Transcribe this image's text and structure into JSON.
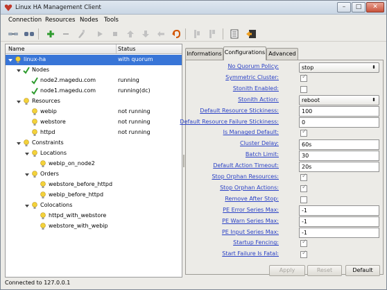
{
  "window": {
    "title": "Linux HA Management Client",
    "controls": [
      "–",
      "□",
      "✕"
    ]
  },
  "menu": [
    "Connection",
    "Resources",
    "Nodes",
    "Tools"
  ],
  "toolbar": {
    "icons": [
      "connect-icon",
      "disconnect-icon",
      "add-icon",
      "remove-icon",
      "cleanup-icon",
      "start-icon",
      "stop-icon",
      "move-up-icon",
      "move-down-icon",
      "migrate-icon",
      "unmigrate-icon",
      "standby-icon",
      "active-icon",
      "log-viewer-icon",
      "exit-icon"
    ]
  },
  "tree": {
    "columns": [
      "Name",
      "Status"
    ],
    "rows": [
      {
        "label": "linux-ha",
        "status": "with quorum",
        "level": 0,
        "icon": "bulb",
        "expanded": true,
        "selected": true
      },
      {
        "label": "Nodes",
        "status": "",
        "level": 1,
        "icon": "check",
        "expanded": true
      },
      {
        "label": "node2.magedu.com",
        "status": "running",
        "level": 2,
        "icon": "check"
      },
      {
        "label": "node1.magedu.com",
        "status": "running(dc)",
        "level": 2,
        "icon": "check"
      },
      {
        "label": "Resources",
        "status": "",
        "level": 1,
        "icon": "bulb",
        "expanded": true
      },
      {
        "label": "webip",
        "status": "not running",
        "level": 2,
        "icon": "bulb"
      },
      {
        "label": "webstore",
        "status": "not running",
        "level": 2,
        "icon": "bulb"
      },
      {
        "label": "httpd",
        "status": "not running",
        "level": 2,
        "icon": "bulb"
      },
      {
        "label": "Constraints",
        "status": "",
        "level": 1,
        "icon": "bulb",
        "expanded": true
      },
      {
        "label": "Locations",
        "status": "",
        "level": 2,
        "icon": "bulb",
        "expanded": true
      },
      {
        "label": "webip_on_node2",
        "status": "",
        "level": 3,
        "icon": "bulb"
      },
      {
        "label": "Orders",
        "status": "",
        "level": 2,
        "icon": "bulb",
        "expanded": true
      },
      {
        "label": "webstore_before_httpd",
        "status": "",
        "level": 3,
        "icon": "bulb"
      },
      {
        "label": "webip_before_httpd",
        "status": "",
        "level": 3,
        "icon": "bulb"
      },
      {
        "label": "Colocations",
        "status": "",
        "level": 2,
        "icon": "bulb",
        "expanded": true
      },
      {
        "label": "httpd_with_webstore",
        "status": "",
        "level": 3,
        "icon": "bulb"
      },
      {
        "label": "webstore_with_webip",
        "status": "",
        "level": 3,
        "icon": "bulb"
      }
    ]
  },
  "tabs": [
    "Informations",
    "Configurations",
    "Advanced"
  ],
  "active_tab": "Configurations",
  "config": [
    {
      "label": "No Quorum Policy:",
      "type": "select",
      "value": "stop"
    },
    {
      "label": "Symmetric Cluster:",
      "type": "check",
      "value": true
    },
    {
      "label": "Stonith Enabled:",
      "type": "check",
      "value": false
    },
    {
      "label": "Stonith Action:",
      "type": "select",
      "value": "reboot"
    },
    {
      "label": "Default Resource Stickiness:",
      "type": "text",
      "value": "100"
    },
    {
      "label": "Default Resource Failure Stickiness:",
      "type": "text",
      "value": "0"
    },
    {
      "label": "Is Managed Default:",
      "type": "check",
      "value": true
    },
    {
      "label": "Cluster Delay:",
      "type": "text",
      "value": "60s"
    },
    {
      "label": "Batch Limit:",
      "type": "text",
      "value": "30"
    },
    {
      "label": "Default Action Timeout:",
      "type": "text",
      "value": "20s"
    },
    {
      "label": "Stop Orphan Resources:",
      "type": "check",
      "value": true
    },
    {
      "label": "Stop Orphan Actions:",
      "type": "check",
      "value": true
    },
    {
      "label": "Remove After Stop:",
      "type": "check",
      "value": false
    },
    {
      "label": "PE Error Series Max:",
      "type": "text",
      "value": "-1"
    },
    {
      "label": "PE Warn Series Max:",
      "type": "text",
      "value": "-1"
    },
    {
      "label": "PE Input Series Max:",
      "type": "text",
      "value": "-1"
    },
    {
      "label": "Startup Fencing:",
      "type": "check",
      "value": true
    },
    {
      "label": "Start Failure Is Fatal:",
      "type": "check",
      "value": true
    }
  ],
  "buttons": {
    "apply": "Apply",
    "reset": "Reset",
    "default": "Default"
  },
  "statusbar": {
    "text": "Connected to 127.0.0.1"
  },
  "colors": {
    "selection": "#3875d7",
    "link_label": "#2a41c5",
    "check_green": "#2e9b2e",
    "bulb_yellow": "#f3d23a"
  }
}
